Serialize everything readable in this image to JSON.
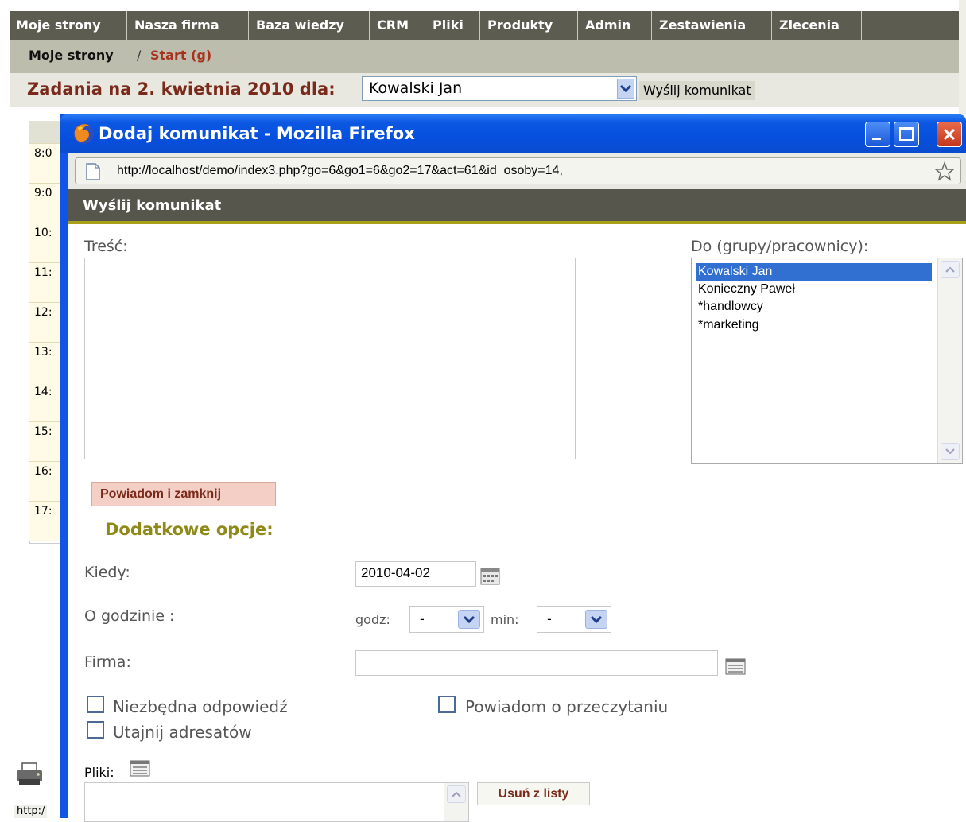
{
  "nav": {
    "tabs": [
      {
        "label": "Moje strony"
      },
      {
        "label": "Nasza firma"
      },
      {
        "label": "Baza wiedzy"
      },
      {
        "label": "CRM"
      },
      {
        "label": "Pliki"
      },
      {
        "label": "Produkty"
      },
      {
        "label": "Admin"
      },
      {
        "label": "Zestawienia"
      },
      {
        "label": "Zlecenia"
      }
    ]
  },
  "breadcrumb": {
    "first": "Moje strony",
    "separator": "/",
    "current": "Start (g)"
  },
  "tasks": {
    "title": "Zadania na 2. kwietnia 2010 dla:",
    "selected_person": "Kowalski Jan",
    "send_message_label": "Wyślij komunikat"
  },
  "calendar": {
    "hours": [
      "8:0",
      "9:0",
      "10:",
      "11:",
      "12:",
      "13:",
      "14:",
      "15:",
      "16:",
      "17:"
    ]
  },
  "status_bar": {
    "text": "http:/"
  },
  "popup": {
    "window_title": "Dodaj komunikat - Mozilla Firefox",
    "url": "http://localhost/demo/index3.php?go=6&go1=6&go2=17&act=61&id_osoby=14,",
    "header_title": "Wyślij komunikat",
    "content_label": "Treść:",
    "recipients_label": "Do (grupy/pracownicy):",
    "recipients": [
      {
        "label": "Kowalski Jan",
        "selected": true
      },
      {
        "label": "Konieczny Paweł",
        "selected": false
      },
      {
        "label": "*handlowcy",
        "selected": false
      },
      {
        "label": "*marketing",
        "selected": false
      }
    ],
    "notify_close_label": "Powiadom i zamknij",
    "extra_options_title": "Dodatkowe opcje:",
    "when_label": "Kiedy:",
    "date_value": "2010-04-02",
    "time_label": "O godzinie :",
    "hour_label": "godz:",
    "hour_value": "-",
    "minute_label": "min:",
    "minute_value": "-",
    "company_label": "Firma:",
    "company_value": "",
    "checkboxes": {
      "required_reply": "Niezbędna odpowiedź",
      "read_receipt": "Powiadom o przeczytaniu",
      "hide_recipients": "Utajnij adresatów"
    },
    "files_label": "Pliki:",
    "remove_from_list_label": "Usuń z listy"
  },
  "colors": {
    "nav_bg": "#5c5c51",
    "crumb_bg": "#bdbdae",
    "accent_red": "#a8321e",
    "olive_accent": "#a7a018",
    "xp_blue": "#0c58e2",
    "selection_blue": "#3170d0"
  },
  "icons": [
    "firefox-icon",
    "minimize-icon",
    "maximize-icon",
    "close-icon",
    "page-icon",
    "bookmark-star-icon",
    "calendar-icon",
    "list-icon",
    "printer-icon",
    "chevron-down-icon"
  ]
}
